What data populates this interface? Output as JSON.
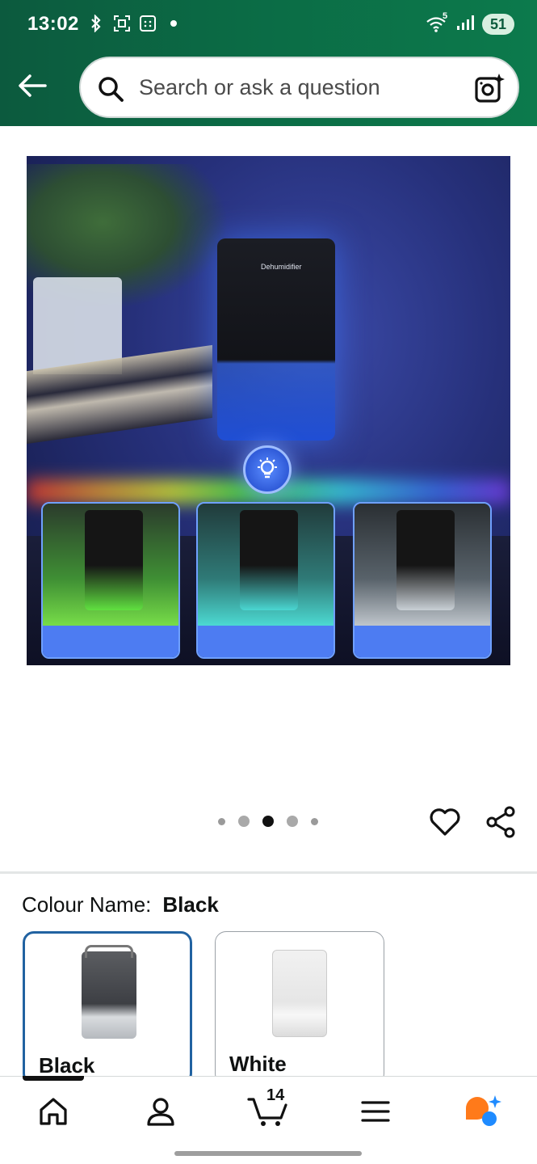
{
  "status_bar": {
    "time": "13:02",
    "battery": "51",
    "network_tag": "5"
  },
  "header": {
    "back_icon": "back-arrow-icon",
    "search_placeholder": "Search or ask a question",
    "camera_icon": "camera-search-icon"
  },
  "product_image": {
    "device_text": "Dehumidifier",
    "carousel": {
      "total": 5,
      "active_index": 2
    }
  },
  "actions": {
    "wishlist_icon": "heart-icon",
    "share_icon": "share-icon"
  },
  "variation": {
    "label": "Colour Name:",
    "selected_value": "Black",
    "options": [
      {
        "label": "Black",
        "selected": true
      },
      {
        "label": "White",
        "selected": false
      }
    ]
  },
  "bottom_nav": {
    "items": [
      {
        "icon": "home-icon",
        "active": true
      },
      {
        "icon": "account-icon",
        "active": false
      },
      {
        "icon": "cart-icon",
        "badge": "14",
        "active": false
      },
      {
        "icon": "menu-icon",
        "active": false
      },
      {
        "icon": "rufus-ai-icon",
        "active": false
      }
    ]
  },
  "colors": {
    "header_green": "#0b6b45",
    "selected_border": "#2162a1",
    "ai_orange": "#ff7a1a",
    "ai_blue": "#1f8bff"
  }
}
